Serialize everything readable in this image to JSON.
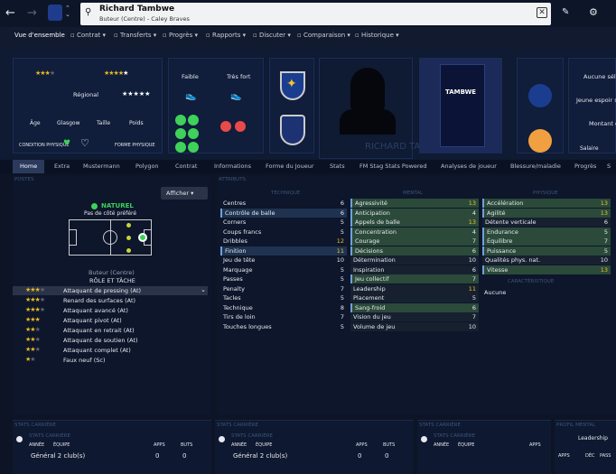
{
  "player": {
    "name": "Richard Tambwe",
    "subtitle": "Buteur (Centre) - Caley Braves",
    "display_name": "RICHARD TAMBWE",
    "shirt_name": "TAMBWE"
  },
  "nav": {
    "items": [
      "Vue d'ensemble",
      "Contrat",
      "Transferts",
      "Progrès",
      "Rapports",
      "Discuter",
      "Comparaison",
      "Historique"
    ]
  },
  "profile": {
    "foot_weak": "Faible",
    "foot_strong": "Très fort",
    "reputation": "Régional",
    "age_label": "Âge",
    "city": "Glasgow",
    "height_label": "Taille",
    "weight_label": "Poids",
    "condition_label": "CONDITION PHYSIQUE",
    "form_label": "FORME PHYSIQUE",
    "right_top": "Aucune séle",
    "right_mid": "Jeune espoir s",
    "right_mid2": "Montant d",
    "salary_label": "Salaire"
  },
  "tabs": [
    "Home",
    "Extra",
    "Mustermann",
    "Polygon",
    "Contrat",
    "Informations",
    "Forme du Joueur",
    "Stats",
    "FM Stag Stats Powered",
    "Analyses de joueur",
    "Blessure/maladie",
    "Progrès",
    "S"
  ],
  "left": {
    "header": "POSTES",
    "natural": "NATUREL",
    "sub": "Pas de côté préféré",
    "position": "Buteur (Centre)",
    "roles_title": "RÔLE ET TÂCHE",
    "show_button": "Afficher",
    "roles": [
      "Attaquant de pressing (At)",
      "Renard des surfaces (At)",
      "Attaquant avancé (At)",
      "Attaquant pivot (At)",
      "Attaquant en retrait (At)",
      "Attaquant de soutien (At)",
      "Attaquant complet (At)",
      "Faux neuf (Sc)"
    ]
  },
  "attributes": {
    "header": "ATTRIBUTS",
    "technique_title": "TECHNIQUE",
    "mental_title": "MENTAL",
    "physique_title": "PHYSIQUE",
    "goal_title": "CARACTÉRISTIQUE",
    "technique": [
      [
        "Centres",
        "6"
      ],
      [
        "Contrôle de balle",
        "6"
      ],
      [
        "Corners",
        "5"
      ],
      [
        "Coups francs",
        "5"
      ],
      [
        "Dribbles",
        "12"
      ],
      [
        "Finition",
        "11"
      ],
      [
        "Jeu de tête",
        "10"
      ],
      [
        "Marquage",
        "5"
      ],
      [
        "Passes",
        "5"
      ],
      [
        "Penalty",
        "7"
      ],
      [
        "Tacles",
        "5"
      ],
      [
        "Technique",
        "8"
      ],
      [
        "Tirs de loin",
        "7"
      ],
      [
        "Touches longues",
        "5"
      ]
    ],
    "mental": [
      [
        "Agressivité",
        "13"
      ],
      [
        "Anticipation",
        "4"
      ],
      [
        "Appels de balle",
        "13"
      ],
      [
        "Concentration",
        "4"
      ],
      [
        "Courage",
        "7"
      ],
      [
        "Décisions",
        "6"
      ],
      [
        "Détermination",
        "10"
      ],
      [
        "Inspiration",
        "6"
      ],
      [
        "Jeu collectif",
        "7"
      ],
      [
        "Leadership",
        "11"
      ],
      [
        "Placement",
        "5"
      ],
      [
        "Sang-froid",
        "6"
      ],
      [
        "Vision du jeu",
        "7"
      ],
      [
        "Volume de jeu",
        "10"
      ]
    ],
    "physique": [
      [
        "Accélération",
        "13"
      ],
      [
        "Agilité",
        "13"
      ],
      [
        "Détente verticale",
        "6"
      ],
      [
        "Endurance",
        "5"
      ],
      [
        "Équilibre",
        "7"
      ],
      [
        "Puissance",
        "5"
      ],
      [
        "Qualités phys. nat.",
        "10"
      ],
      [
        "Vitesse",
        "13"
      ]
    ],
    "trait": "Aucune"
  },
  "bottom": {
    "stats_title": "STATS CARRIÈRE",
    "year_label": "ANNÉE",
    "team_label": "ÉQUIPE",
    "apps_label": "APPS",
    "goals_label": "BUTS",
    "general": "Général 2 club(s)",
    "apps": "0",
    "goals": "0",
    "dash": "-",
    "mental_prof": "PROFIL MENTAL",
    "leadership": "Leadership",
    "dec_label": "DÉC",
    "pass_label": "PASS"
  },
  "colors": {
    "accent": "#2f6bff",
    "green": "#3fd15a",
    "yellow": "#e8b923",
    "highlight": "#2c3f5f"
  }
}
